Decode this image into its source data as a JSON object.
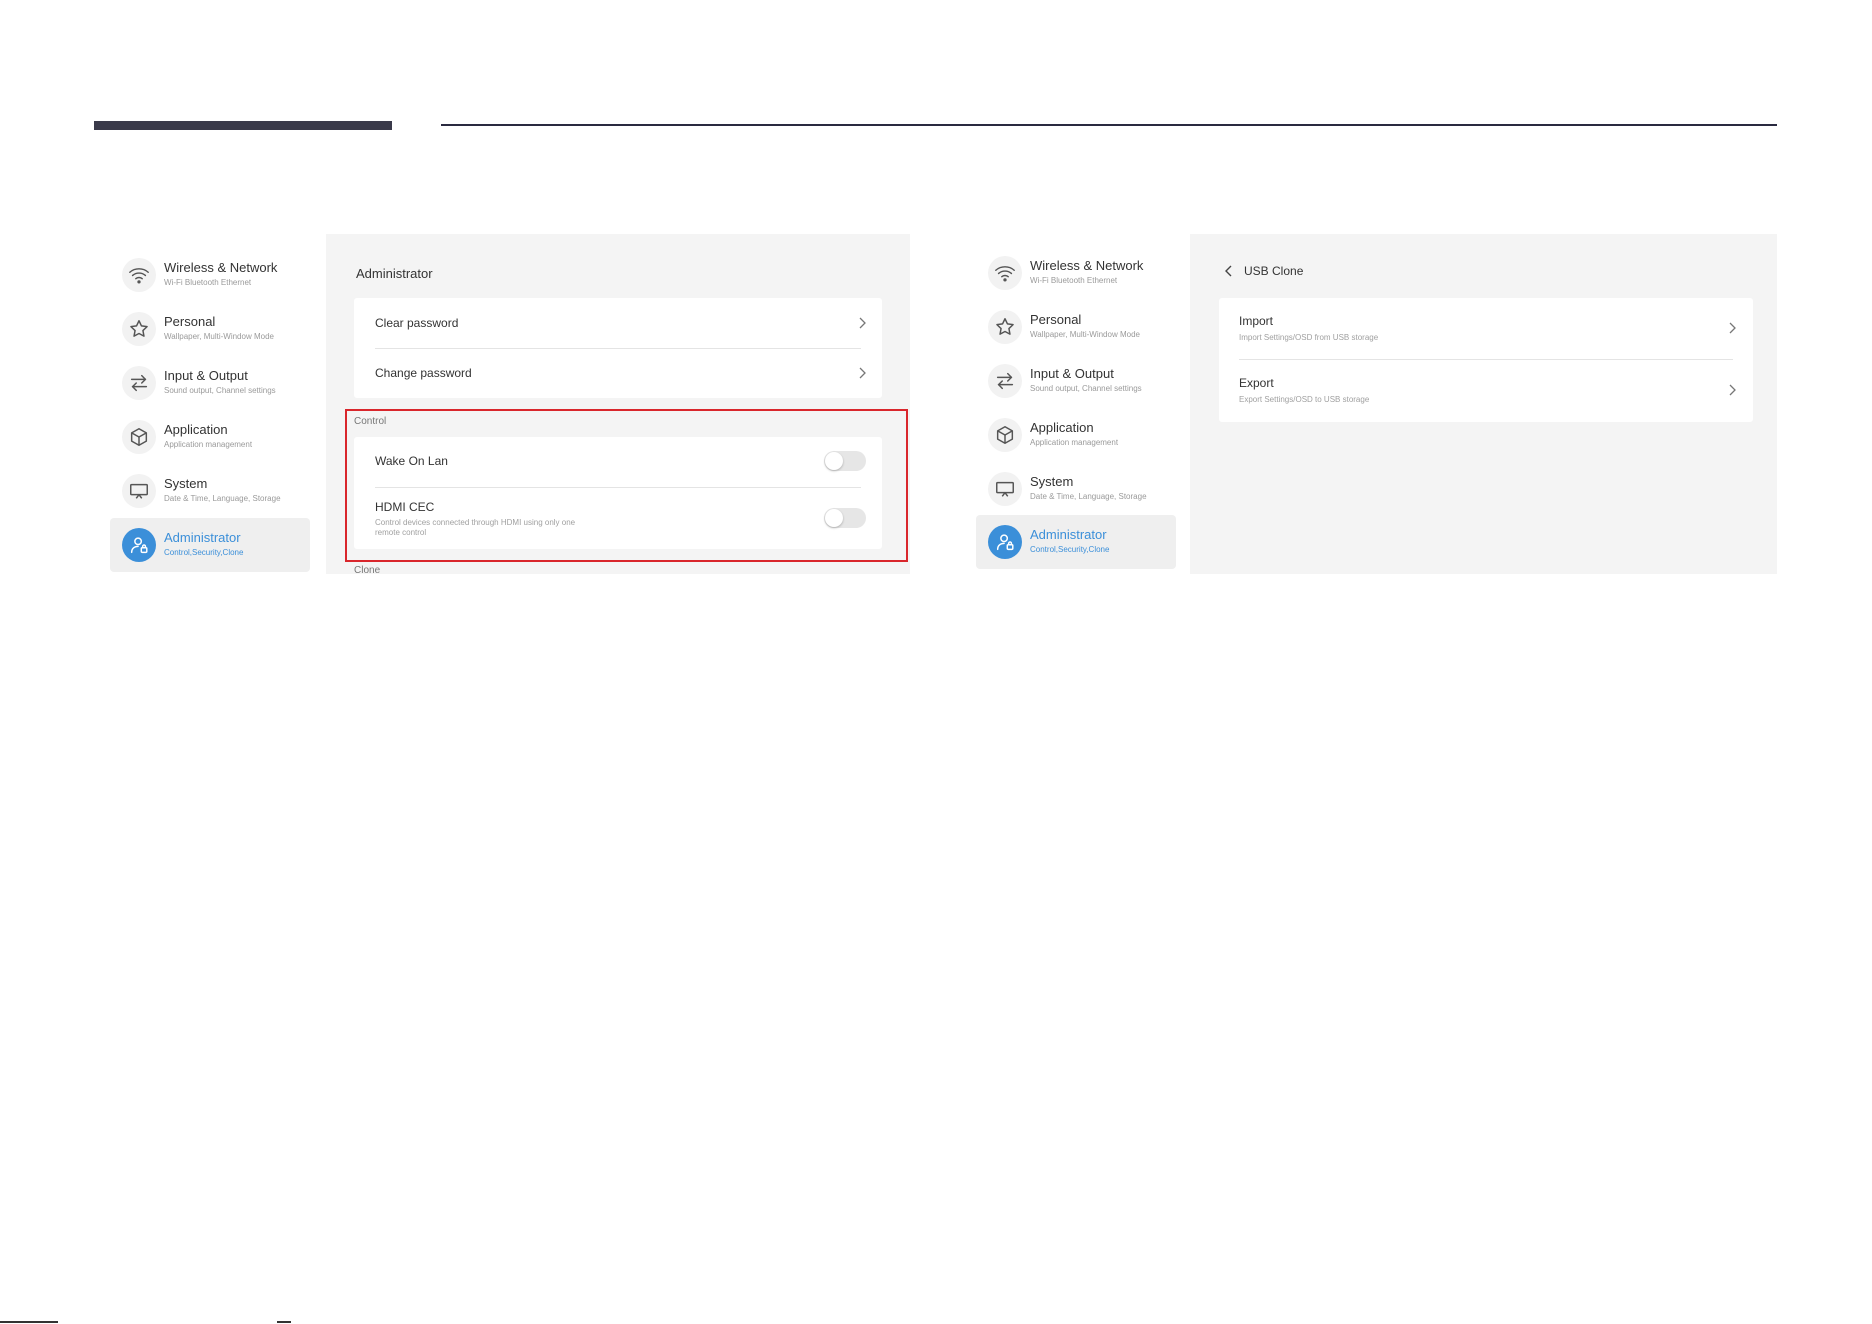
{
  "colors": {
    "accent": "#3b8fd9",
    "highlight": "#d9262c",
    "content_bg": "#f4f4f4"
  },
  "sidebar": {
    "items": [
      {
        "label": "Wireless & Network",
        "sub": "Wi-Fi Bluetooth Ethernet",
        "icon": "wifi-icon"
      },
      {
        "label": "Personal",
        "sub": "Wallpaper, Multi-Window Mode",
        "icon": "star-icon"
      },
      {
        "label": "Input & Output",
        "sub": "Sound output, Channel settings",
        "icon": "swap-arrows-icon"
      },
      {
        "label": "Application",
        "sub": "Application management",
        "icon": "cube-icon"
      },
      {
        "label": "System",
        "sub": "Date & Time, Language, Storage",
        "icon": "monitor-icon"
      },
      {
        "label": "Administrator",
        "sub": "Control,Security,Clone",
        "icon": "admin-user-icon",
        "active": true
      }
    ]
  },
  "left_panel": {
    "title": "Administrator",
    "clear_password": "Clear password",
    "change_password": "Change password",
    "control_section": "Control",
    "wake_on_lan": {
      "label": "Wake On Lan",
      "enabled": false
    },
    "hdmi_cec": {
      "label": "HDMI CEC",
      "sub": "Control devices connected through HDMI using only one remote control",
      "enabled": false
    },
    "clone_section": "Clone"
  },
  "right_panel": {
    "title": "USB Clone",
    "import": {
      "label": "Import",
      "sub": "Import Settings/OSD from USB storage"
    },
    "export": {
      "label": "Export",
      "sub": "Export Settings/OSD to USB storage"
    }
  }
}
